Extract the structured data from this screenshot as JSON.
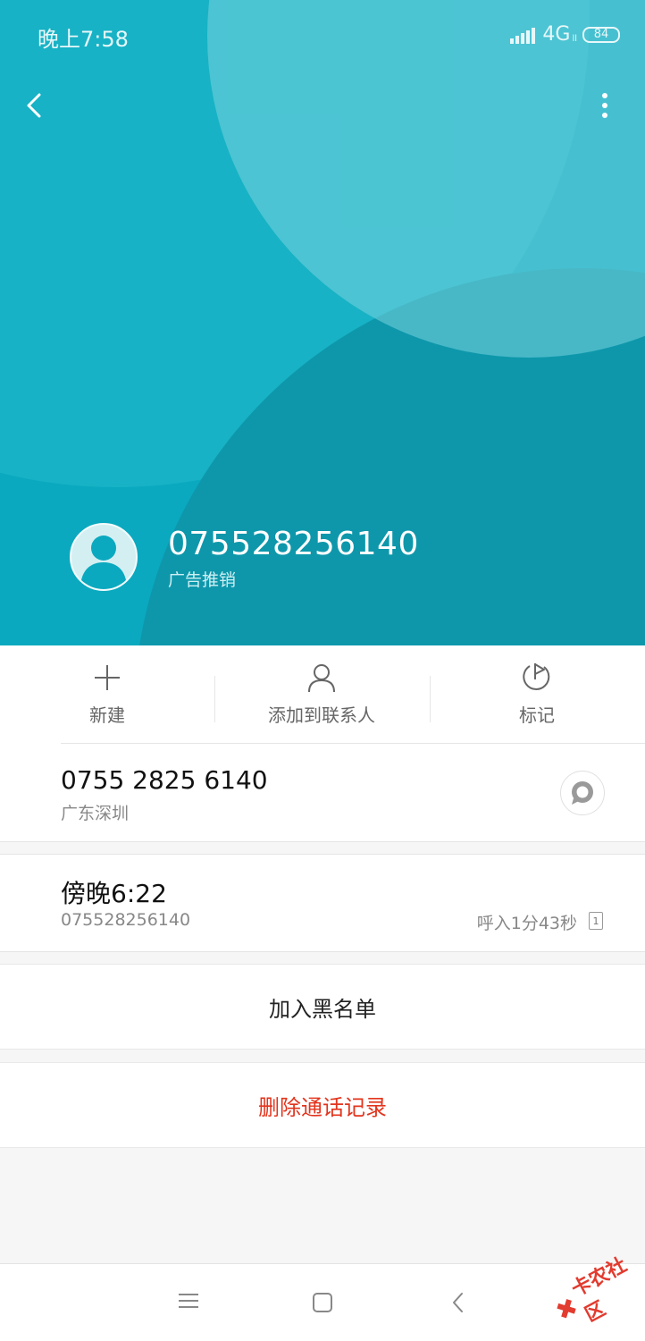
{
  "status_bar": {
    "time": "晚上7:58",
    "network": "4G",
    "network_sub": "ll",
    "battery": "84"
  },
  "header": {
    "number": "075528256140",
    "tag": "广告推销",
    "background_color": "#0aa9bf"
  },
  "actions": [
    {
      "label": "新建",
      "icon": "plus-icon"
    },
    {
      "label": "添加到联系人",
      "icon": "person-icon"
    },
    {
      "label": "标记",
      "icon": "flag-icon"
    }
  ],
  "number_card": {
    "formatted_number": "0755 2825 6140",
    "location": "广东深圳"
  },
  "call_record": {
    "time": "傍晚6:22",
    "number": "075528256140",
    "detail": "呼入1分43秒",
    "sim": "1"
  },
  "buttons": {
    "blacklist": "加入黑名单",
    "delete_history": "删除通话记录",
    "delete_color": "#e2341d"
  },
  "watermark": {
    "mark": "✖",
    "text": "卡农社区"
  }
}
